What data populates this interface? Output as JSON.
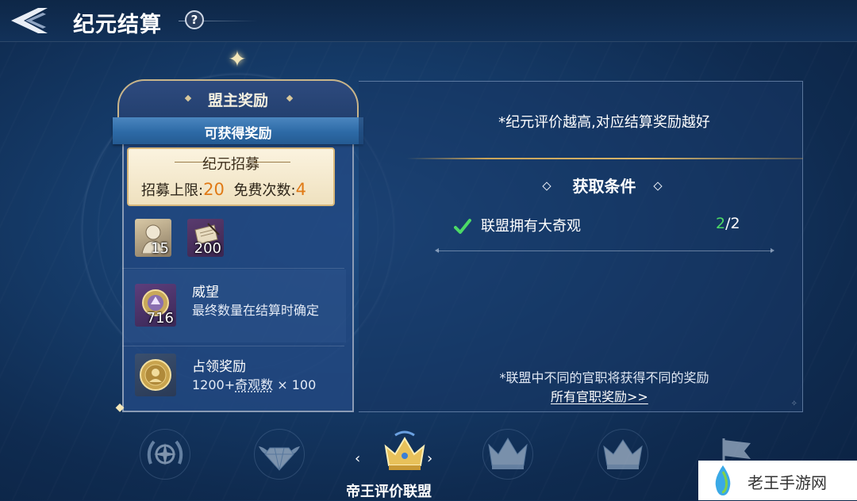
{
  "header": {
    "title": "纪元结算",
    "help_label": "?"
  },
  "left_card": {
    "title": "盟主奖励",
    "ribbon_label": "可获得奖励",
    "recruit": {
      "title": "纪元招募",
      "limit_label": "招募上限:",
      "limit_value": "20",
      "free_label": "免费次数:",
      "free_value": "4"
    },
    "items": [
      {
        "icon": "general-portrait-icon",
        "count": "15"
      },
      {
        "icon": "scroll-quill-icon",
        "count": "200"
      }
    ],
    "prestige": {
      "icon": "prestige-medal-icon",
      "count": "716",
      "title": "威望",
      "desc": "最终数量在结算时确定"
    },
    "occupation": {
      "icon": "gold-coin-icon",
      "title": "占领奖励",
      "desc_prefix": "1200+",
      "desc_link": "奇观数",
      "desc_suffix": " × 100"
    }
  },
  "right_panel": {
    "tip": "*纪元评价越高,对应结算奖励越好",
    "conditions_title": "获取条件",
    "conditions": [
      {
        "label": "联盟拥有大奇观",
        "current": "2",
        "total": "/2",
        "done": true
      }
    ],
    "note": "*联盟中不同的官职将获得不同的奖励",
    "link": "所有官职奖励>>"
  },
  "tiers": {
    "selected_label": "帝王评价联盟",
    "items": [
      "wreath-compass-icon",
      "winged-diamond-icon",
      "gold-crown-icon",
      "crown-icon",
      "crown-icon",
      "flag-icon"
    ]
  },
  "watermark": {
    "text": "老王手游网"
  },
  "colors": {
    "accent_gold": "#c9a45a",
    "highlight_orange": "#e07a16",
    "success_green": "#4cd966"
  }
}
